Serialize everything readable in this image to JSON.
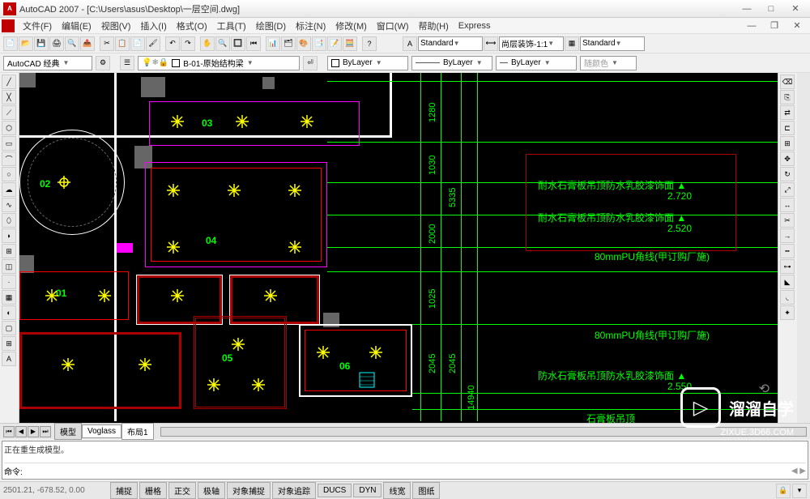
{
  "title": "AutoCAD 2007 - [C:\\Users\\asus\\Desktop\\一层空间.dwg]",
  "menus": [
    "文件(F)",
    "编辑(E)",
    "视图(V)",
    "插入(I)",
    "格式(O)",
    "工具(T)",
    "绘图(D)",
    "标注(N)",
    "修改(M)",
    "窗口(W)",
    "帮助(H)",
    "Express"
  ],
  "workspace": "AutoCAD 经典",
  "layer": "B-01-原始结构梁",
  "style1": "Standard",
  "style2": "尚层装饰-1:1",
  "style3": "Standard",
  "prop_layer": "ByLayer",
  "prop_ltype": "ByLayer",
  "prop_lweight": "ByLayer",
  "prop_color": "随颜色",
  "tabs": [
    "模型",
    "Voglass",
    "布局1"
  ],
  "cmd_history": "正在重生成模型。",
  "cmd_prompt": "命令:",
  "coords": "2501.21, -678.52, 0.00",
  "status_buttons": [
    "捕捉",
    "栅格",
    "正交",
    "极轴",
    "对象捕捉",
    "对象追踪",
    "DUCS",
    "DYN",
    "线宽",
    "图纸"
  ],
  "dimensions": {
    "d1": "1280",
    "d2": "1030",
    "d3": "5335",
    "d4": "2000",
    "d5": "1025",
    "d6": "2045",
    "d7": "2045",
    "d8": "14940"
  },
  "annotations": {
    "a1": "耐水石膏板吊顶防水乳胶漆饰面",
    "a1v": "2.720",
    "a2": "耐水石膏板吊顶防水乳胶漆饰面",
    "a2v": "2.520",
    "a3": "80mmPU角线(甲订购厂施)",
    "a4": "80mmPU角线(甲订购厂施)",
    "a5": "防水石膏板吊顶防水乳胶漆饰面",
    "a5v": "2.550",
    "a6": "石膏板吊顶"
  },
  "rooms": {
    "r1": "01",
    "r2": "02",
    "r3": "03",
    "r4": "04",
    "r5": "05",
    "r6": "06"
  },
  "watermark": {
    "brand": "溜溜自学",
    "url": "ZIXUE.3D66.COM"
  }
}
